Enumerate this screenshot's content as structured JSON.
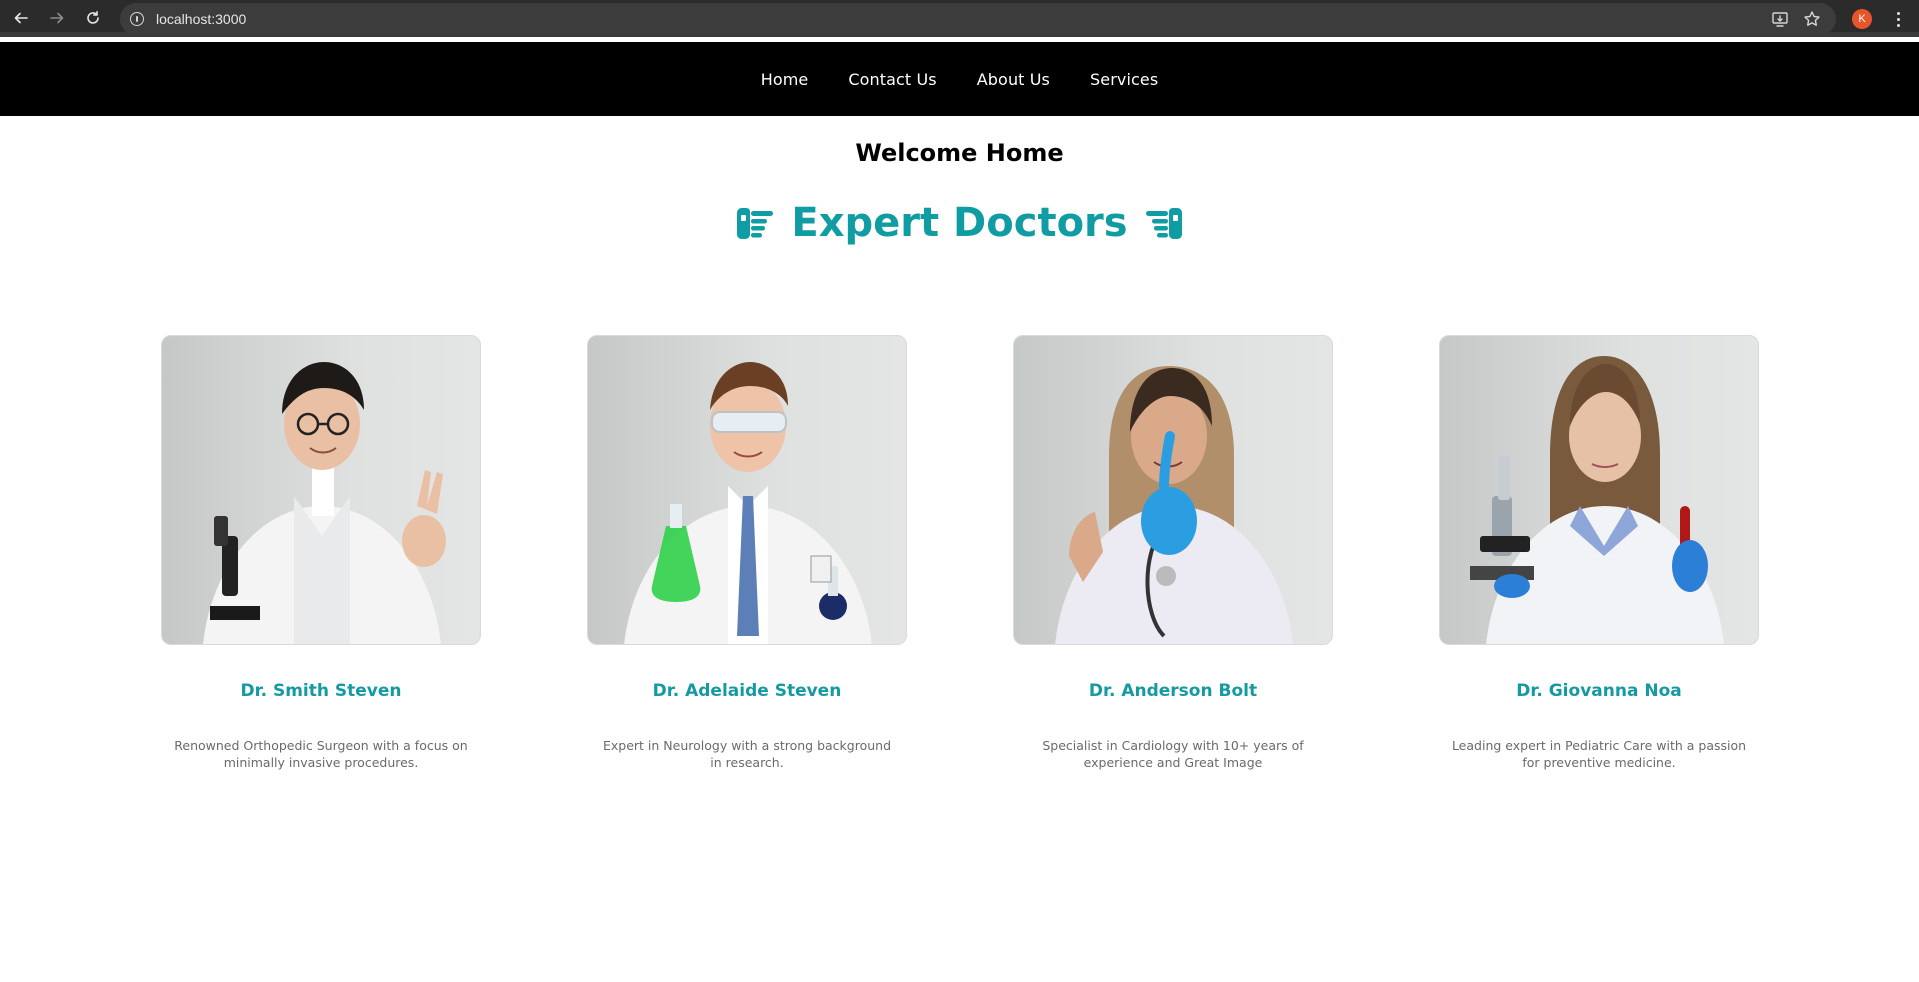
{
  "browser": {
    "url": "localhost:3000",
    "profile_initial": "K"
  },
  "nav": {
    "items": [
      "Home",
      "Contact Us",
      "About Us",
      "Services"
    ]
  },
  "page": {
    "welcome_title": "Welcome Home",
    "section_title": "Expert Doctors",
    "accent_color": "#109ca3"
  },
  "doctors": [
    {
      "name": "Dr. Smith Steven",
      "description": "Renowned Orthopedic Surgeon with a focus on minimally invasive procedures."
    },
    {
      "name": "Dr. Adelaide Steven",
      "description": "Expert in Neurology with a strong background in research."
    },
    {
      "name": "Dr. Anderson Bolt",
      "description": "Specialist in Cardiology with 10+ years of experience and Great Image"
    },
    {
      "name": "Dr. Giovanna Noa",
      "description": "Leading expert in Pediatric Care with a passion for preventive medicine."
    }
  ]
}
